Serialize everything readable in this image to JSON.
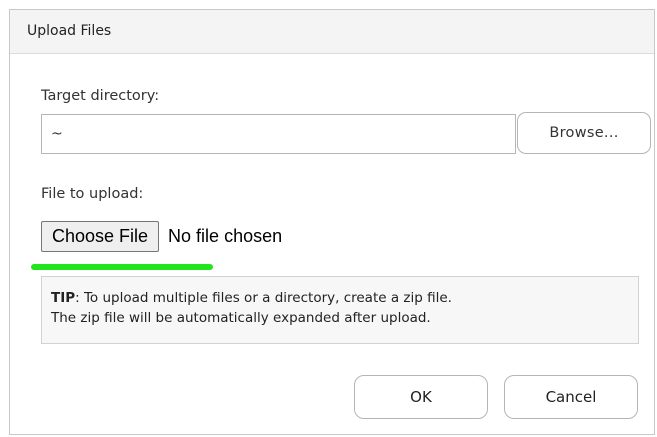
{
  "dialog": {
    "title": "Upload Files"
  },
  "target_directory": {
    "label": "Target directory:",
    "value": "~",
    "browse_label": "Browse..."
  },
  "file_upload": {
    "label": "File to upload:",
    "choose_label": "Choose File",
    "status": "No file chosen"
  },
  "tip": {
    "prefix": "TIP",
    "text": ": To upload multiple files or a directory, create a zip file.",
    "text2": "The zip file will be automatically expanded after upload."
  },
  "buttons": {
    "ok": "OK",
    "cancel": "Cancel"
  },
  "colors": {
    "highlight": "#22e51d"
  }
}
